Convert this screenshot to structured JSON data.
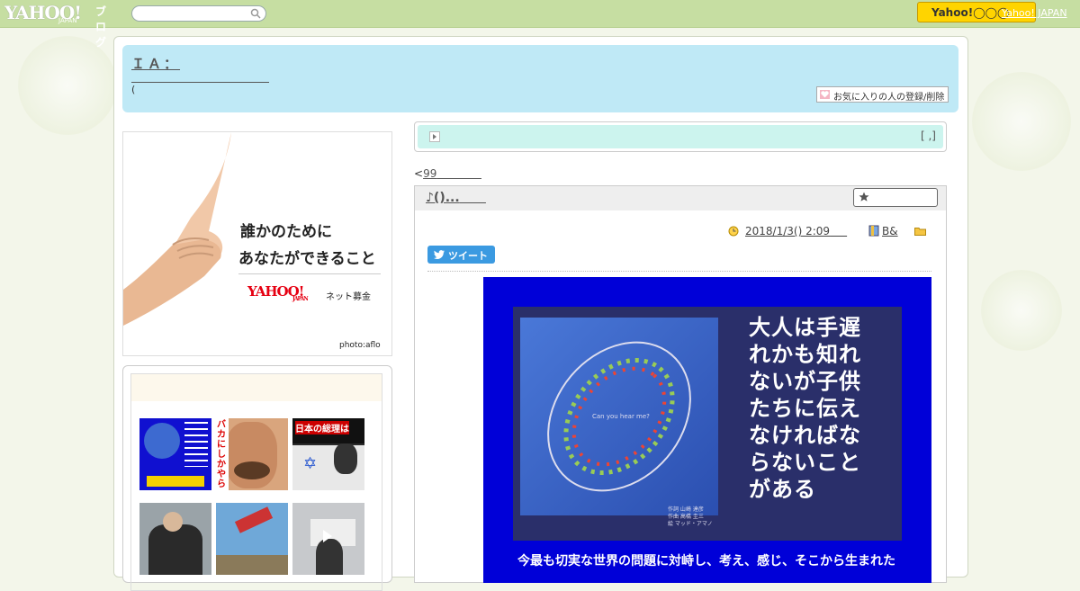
{
  "masthead": {
    "logo_text": "YAHOO!",
    "logo_sub": "JAPAN",
    "blog_label": "ブログ",
    "search_placeholder": "",
    "yahoo_button": "Yahoo!◯◯◯",
    "yahoo_japan_link": "Yahoo! JAPAN"
  },
  "header": {
    "title": "ＩＡ：",
    "description": "(",
    "fav_button": "お気に入りの人の登録/削除"
  },
  "ad": {
    "headline1": "誰かのために",
    "headline2": "あなたができること",
    "brand": "YAHOO!",
    "brand_sub": "JAPAN",
    "service": "ネット募金",
    "credit": "photo:aflo"
  },
  "thumbnails": {
    "items": [
      {
        "name": "thumb-1",
        "caption": ""
      },
      {
        "name": "thumb-2",
        "caption": "バカにしかやら"
      },
      {
        "name": "thumb-3",
        "caption": "日本の総理は"
      },
      {
        "name": "thumb-4",
        "caption": ""
      },
      {
        "name": "thumb-5",
        "caption": ""
      },
      {
        "name": "thumb-6",
        "caption": ""
      }
    ]
  },
  "info_bar": {
    "right_text": "[ ,]"
  },
  "nav": {
    "prev_prefix": "<",
    "prev_link": "99"
  },
  "article": {
    "title": "♪()...",
    "date": "2018/1/3()  2:09",
    "category": "B&",
    "tweet_label": "ツイート",
    "image_text": [
      "大人は手遅",
      "れかも知れ",
      "ないが子供",
      "たちに伝え",
      "なければな",
      "らないこと",
      "がある"
    ],
    "image_bottom": "今最も切実な世界の問題に対峙し、考え、感じ、そこから生まれた",
    "image_ring_text": "Can you hear me?"
  },
  "colors": {
    "masthead": "#c6dea2",
    "header": "#bfe9f6",
    "info_bar": "#ccf4ee",
    "tweet": "#3b9ae1",
    "post_blue": "#0000d8"
  }
}
